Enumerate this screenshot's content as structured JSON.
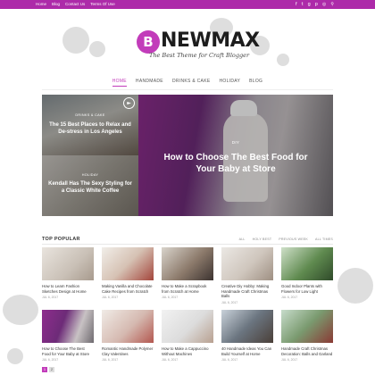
{
  "topbar": {
    "links": [
      "Home",
      "Blog",
      "Contact Us",
      "Terms Of Use"
    ],
    "social_icons": [
      "f",
      "t",
      "g+",
      "p",
      "ig",
      "search"
    ]
  },
  "logo": {
    "mark": "B",
    "title": "NEWMAX",
    "tagline": "The Best Theme for Craft Blogger"
  },
  "nav": {
    "items": [
      "HOME",
      "HANDMADE",
      "DRINKS & CAKE",
      "HOLIDAY",
      "BLOG"
    ],
    "active_index": 0
  },
  "hero": {
    "small1": {
      "category": "DRINKS & CAKE",
      "title": "The 15 Best Places to Relax and De-stress in Los Angeles"
    },
    "small2": {
      "category": "HOLIDAY",
      "title": "Kendall Has The Sexy Styling for a Classic White Coffee"
    },
    "big": {
      "category": "DIY",
      "title": "How to Choose The Best Food for Your Baby at Store"
    },
    "play_icon": "►"
  },
  "popular": {
    "title": "TOP POPULAR",
    "filters": [
      "ALL",
      "HOLY BEST",
      "PREVIOUS WEEK",
      "ALL TIMES"
    ],
    "posts": [
      {
        "title": "How to Learn Fashion Sketches Design at Home",
        "date": "JUL 6, 2017"
      },
      {
        "title": "Making Vanilla and Chocolate Cake Recipes from Scratch",
        "date": "JUL 6, 2017"
      },
      {
        "title": "How to Make a Scrapbook from Scratch at Home",
        "date": "JUL 6, 2017"
      },
      {
        "title": "Creative Diy Hobby: Making Handmade Craft Christmas Balls",
        "date": "JUL 6, 2017"
      },
      {
        "title": "Good Indoor Plants with Flowers for Low Light",
        "date": "JUL 6, 2017"
      },
      {
        "title": "How to Choose The Best Food for Your Baby at Store",
        "date": "JUL 6, 2017"
      },
      {
        "title": "Romantic Handmade Polymer Clay Valentines",
        "date": "JUL 6, 2017"
      },
      {
        "title": "How to Make a Cappuccino Without Machines",
        "date": "JUL 6, 2017"
      },
      {
        "title": "40 Handmade Ideas You Can Build Yourself at Home",
        "date": "JUL 6, 2017"
      },
      {
        "title": "Handmade Craft Christmas Decoration: Balls and Garland",
        "date": "JUL 6, 2017"
      }
    ]
  },
  "pager": [
    "1",
    "2"
  ],
  "colors": {
    "accent": "#c23cba",
    "topbar": "#ad2aa9"
  }
}
